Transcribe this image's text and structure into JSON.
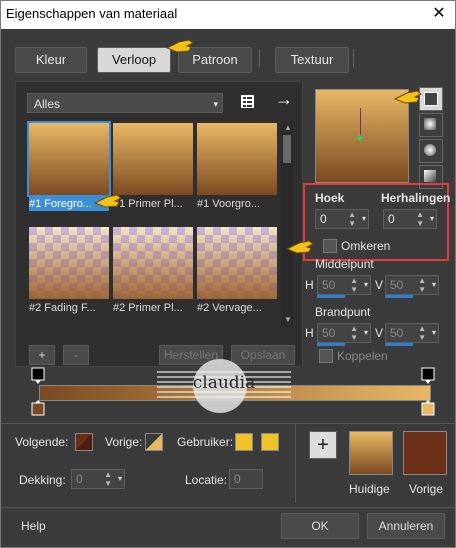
{
  "window": {
    "title": "Eigenschappen van materiaal",
    "close": "✕"
  },
  "tabs": [
    {
      "label": "Kleur",
      "active": false
    },
    {
      "label": "Verloop",
      "active": true
    },
    {
      "label": "Patroon",
      "active": false
    },
    {
      "label": "Textuur",
      "active": false
    }
  ],
  "category": {
    "value": "Alles",
    "arrow": "▾"
  },
  "library_icon": "library-icon",
  "arrow_icon": "→",
  "gradients": [
    {
      "label": "#1 Foregro...",
      "style": "grad1",
      "selected": true
    },
    {
      "label": "#1 Primer Pl...",
      "style": "grad1",
      "selected": false
    },
    {
      "label": "#1 Voorgro...",
      "style": "grad1",
      "selected": false
    },
    {
      "label": "#2 Fading F...",
      "style": "checker2",
      "selected": false
    },
    {
      "label": "#2 Primer Pl...",
      "style": "checker2",
      "selected": false
    },
    {
      "label": "#2 Vervage...",
      "style": "checker2",
      "selected": false
    }
  ],
  "controls": {
    "hoek_label": "Hoek",
    "herhalingen_label": "Herhalingen",
    "hoek_value": "0",
    "herhalingen_value": "0",
    "omkeren_label": "Omkeren",
    "middelpunt_label": "Middelpunt",
    "brandpunt_label": "Brandpunt",
    "h_label": "H",
    "v_label": "V",
    "mid_h": "50",
    "mid_v": "50",
    "brand_h": "50",
    "brand_v": "50",
    "koppelen_label": "Koppelen"
  },
  "editor": {
    "add": "+",
    "remove": "-",
    "herstellen": "Herstellen",
    "opslaan": "Opslaan"
  },
  "watermark": {
    "text": "claudia"
  },
  "bottom": {
    "volgende_label": "Volgende:",
    "vorige_label": "Vorige:",
    "gebruiker_label": "Gebruiker:",
    "dekking_label": "Dekking:",
    "dekking_value": "0",
    "locatie_label": "Locatie:",
    "locatie_value": "0",
    "plus": "+",
    "huidige_label": "Huidige",
    "vorige2_label": "Vorige",
    "help": "Help",
    "ok": "OK",
    "annuleren": "Annuleren"
  },
  "colors": {
    "grad_top": "#e8b866",
    "grad_bottom": "#7b4a22",
    "volgende": "#6a2d1a",
    "gebruiker": "#f0c22a",
    "vorige_swatch": "#6b2f17",
    "accent": "#3b8fd9",
    "highlight": "#e23b3b"
  }
}
